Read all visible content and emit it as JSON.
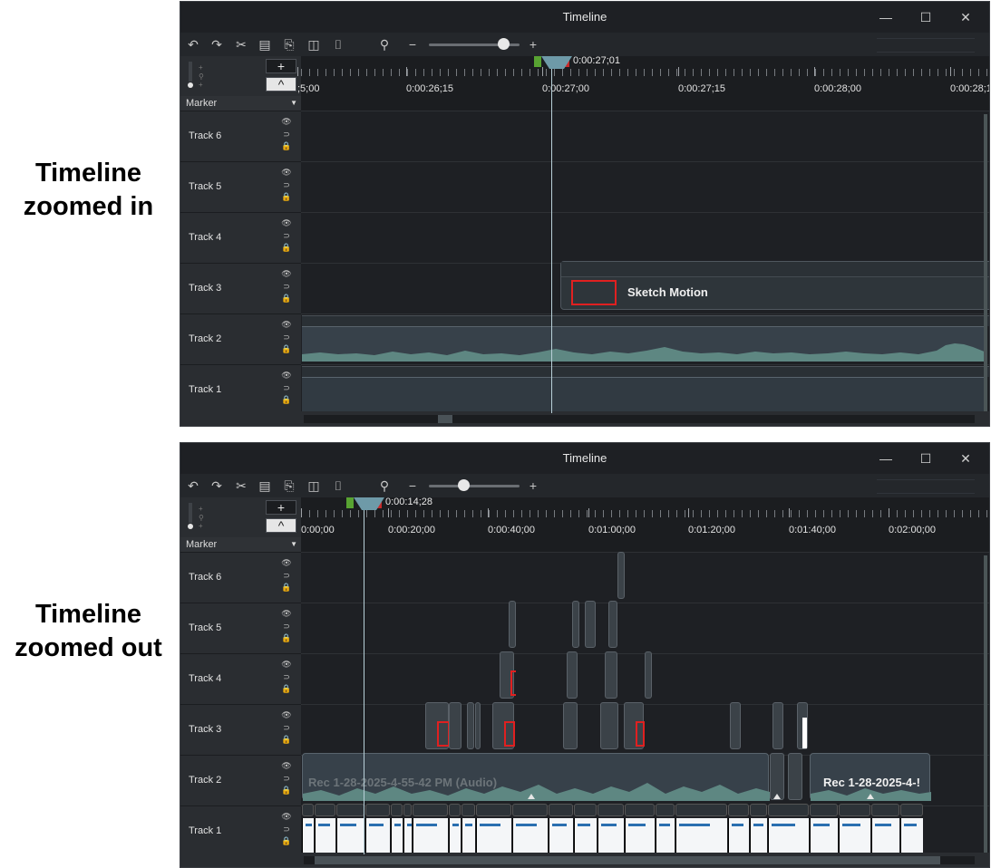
{
  "labels": {
    "top": [
      "Timeline",
      "zoomed in"
    ],
    "bottom": [
      "Timeline",
      "zoomed out"
    ]
  },
  "window": {
    "title": "Timeline",
    "controls": {
      "minimize": "—",
      "maximize": "☐",
      "close": "✕"
    }
  },
  "left_panel": {
    "add_track": "+",
    "collapse": "^",
    "marker_label": "Marker",
    "marker_arrow": "▼"
  },
  "tracks": [
    "Track 6",
    "Track 5",
    "Track 4",
    "Track 3",
    "Track 2",
    "Track 1"
  ],
  "track_icons": {
    "visibility": "👁",
    "magnet": "⊃",
    "lock": "🔒"
  },
  "top": {
    "playhead_time": "0:00:27;01",
    "zoom_level": 0.82,
    "ruler_labels": [
      ";5;00",
      "0:00:26;15",
      "0:00:27;00",
      "0:00:27;15",
      "0:00:28;00",
      "0:00:28;1"
    ],
    "track3_clip_label": "Sketch Motion"
  },
  "bottom": {
    "playhead_time": "0:00:14;28",
    "zoom_level": 0.38,
    "ruler_labels": [
      "0:00;00",
      "0:00:20;00",
      "0:00:40;00",
      "0:01:00;00",
      "0:01:20;00",
      "0:01:40;00",
      "0:02:00;00"
    ],
    "track2_clip_label_dim": "Rec 1-28-2025-4-55-42 PM (Audio)",
    "track2_clip_label": "Rec 1-28-2025-4-!"
  },
  "icons": [
    "undo-icon",
    "redo-icon",
    "cut-icon",
    "copy-icon",
    "paste-icon",
    "split-icon",
    "snapshot-icon",
    "zoom-icon",
    "zoom-out-icon",
    "zoom-in-icon"
  ]
}
